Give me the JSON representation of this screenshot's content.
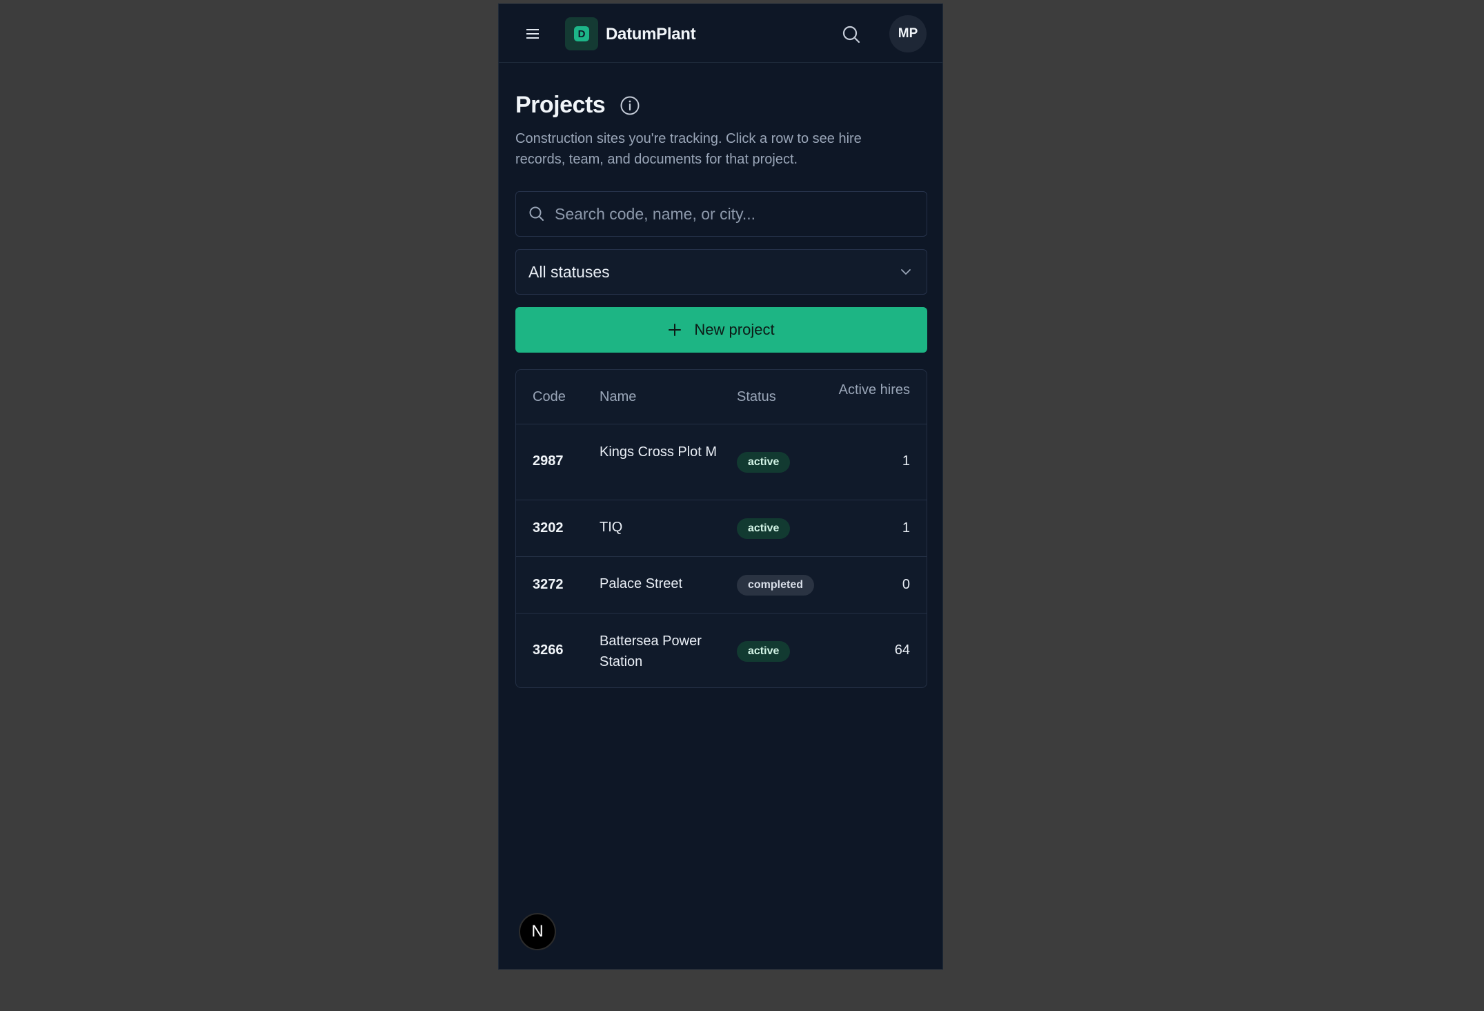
{
  "header": {
    "brand": "DatumPlant",
    "logo_letter": "D",
    "avatar_initials": "MP"
  },
  "page": {
    "title": "Projects",
    "subtitle": "Construction sites you're tracking. Click a row to see hire records, team, and documents for that project."
  },
  "search": {
    "placeholder": "Search code, name, or city...",
    "value": ""
  },
  "filter": {
    "selected": "All statuses"
  },
  "actions": {
    "new_project_label": "New project"
  },
  "table": {
    "columns": {
      "code": "Code",
      "name": "Name",
      "status": "Status",
      "active_hires": "Active hires"
    },
    "rows": [
      {
        "code": "2987",
        "name": "Kings Cross Plot M",
        "status": "active",
        "active_hires": "1"
      },
      {
        "code": "3202",
        "name": "TIQ",
        "status": "active",
        "active_hires": "1"
      },
      {
        "code": "3272",
        "name": "Palace Street",
        "status": "completed",
        "active_hires": "0"
      },
      {
        "code": "3266",
        "name": "Battersea Power Station",
        "status": "active",
        "active_hires": "64"
      }
    ]
  },
  "floating": {
    "label": "N"
  },
  "colors": {
    "background": "#3d3d3d",
    "panel": "#0e1726",
    "accent": "#1db584",
    "active_badge": "#123a31",
    "completed_badge": "#2a3342"
  },
  "icons": {
    "menu": "hamburger-menu-icon",
    "search": "search-icon",
    "info": "info-icon",
    "dropdown": "chevron-down-icon",
    "add": "plus-icon"
  }
}
